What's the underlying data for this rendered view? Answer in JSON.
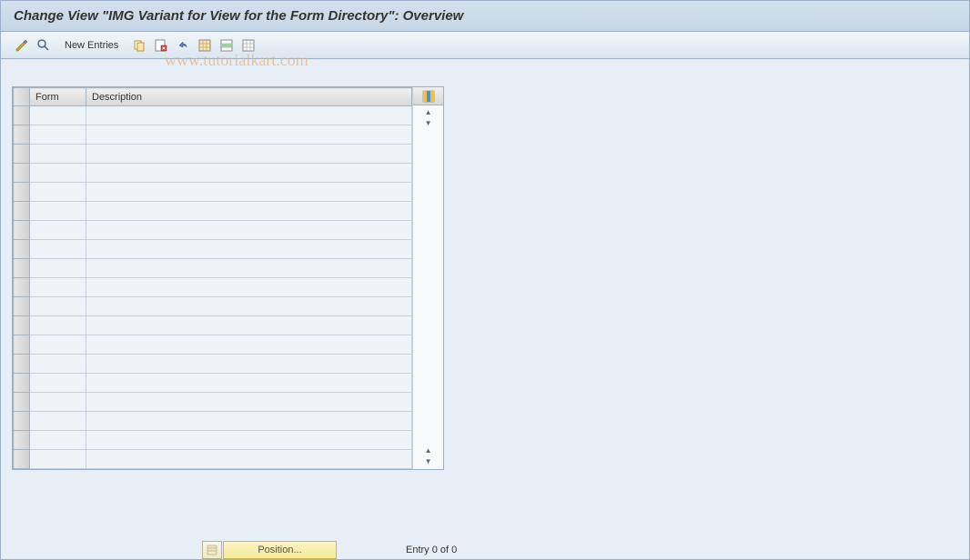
{
  "title": "Change View \"IMG Variant for View for the Form Directory\": Overview",
  "toolbar": {
    "new_entries_label": "New Entries"
  },
  "watermark": "www.tutorialkart.com",
  "table": {
    "columns": {
      "form": "Form",
      "description": "Description"
    },
    "row_count": 19,
    "rows": [
      {
        "form": "",
        "description": ""
      },
      {
        "form": "",
        "description": ""
      },
      {
        "form": "",
        "description": ""
      },
      {
        "form": "",
        "description": ""
      },
      {
        "form": "",
        "description": ""
      },
      {
        "form": "",
        "description": ""
      },
      {
        "form": "",
        "description": ""
      },
      {
        "form": "",
        "description": ""
      },
      {
        "form": "",
        "description": ""
      },
      {
        "form": "",
        "description": ""
      },
      {
        "form": "",
        "description": ""
      },
      {
        "form": "",
        "description": ""
      },
      {
        "form": "",
        "description": ""
      },
      {
        "form": "",
        "description": ""
      },
      {
        "form": "",
        "description": ""
      },
      {
        "form": "",
        "description": ""
      },
      {
        "form": "",
        "description": ""
      },
      {
        "form": "",
        "description": ""
      },
      {
        "form": "",
        "description": ""
      }
    ]
  },
  "footer": {
    "position_label": "Position...",
    "entry_info": "Entry 0 of 0"
  },
  "icons": {
    "change": "change-icon",
    "find": "find-icon",
    "copy": "copy-icon",
    "delete": "delete-icon",
    "undo": "undo-icon",
    "select_all": "select-all-icon",
    "select_block": "select-block-icon",
    "deselect_all": "deselect-all-icon",
    "config": "table-settings-icon"
  }
}
